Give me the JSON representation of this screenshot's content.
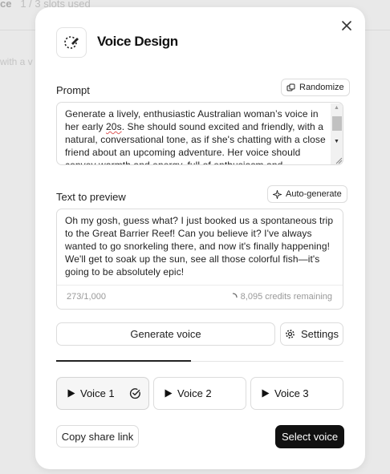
{
  "background": {
    "header_title": "ce",
    "header_meta": "1 / 3 slots used",
    "sub_text": "with a v"
  },
  "modal": {
    "title": "Voice Design",
    "prompt": {
      "label": "Prompt",
      "randomize_label": "Randomize",
      "text_before": "Generate a lively, enthusiastic Australian woman’s voice in her early ",
      "text_misspelled": "20s",
      "text_after": ". She should sound excited and friendly, with a natural, conversational tone, as if she's chatting with a close friend about an upcoming adventure. Her voice should convey warmth and energy, full of enthusiasm and"
    },
    "preview": {
      "label": "Text to preview",
      "auto_generate_label": "Auto-generate",
      "text": "Oh my gosh, guess what? I just booked us a spontaneous trip to the Great Barrier Reef! Can you believe it? I've always wanted to go snorkeling there, and now it's finally happening! We'll get to soak up the sun, see all those colorful fish—it's going to be absolutely epic!",
      "char_count": "273/1,000",
      "credits": "8,095 credits remaining"
    },
    "generate_label": "Generate voice",
    "settings_label": "Settings",
    "progress": 0.47,
    "voices": [
      {
        "label": "Voice 1",
        "selected": true
      },
      {
        "label": "Voice 2",
        "selected": false
      },
      {
        "label": "Voice 3",
        "selected": false
      }
    ],
    "copy_share_label": "Copy share link",
    "select_voice_label": "Select voice"
  }
}
